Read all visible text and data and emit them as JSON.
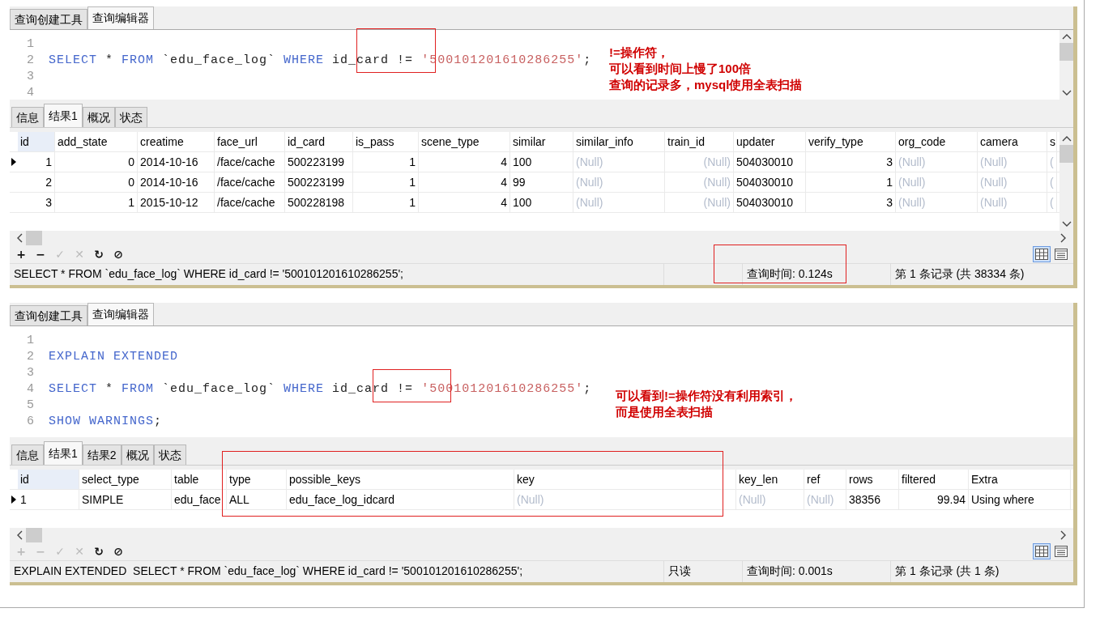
{
  "panels": [
    {
      "query_tabs": [
        {
          "label": "查询创建工具",
          "selected": false
        },
        {
          "label": "查询编辑器",
          "selected": true
        }
      ],
      "editor": {
        "lines": [
          {
            "number": "1"
          },
          {
            "number": "2",
            "tokens": [
              {
                "kind": "keyword",
                "text": "SELECT"
              },
              {
                "kind": "plain",
                "text": " * "
              },
              {
                "kind": "keyword",
                "text": "FROM"
              },
              {
                "kind": "plain",
                "text": " `edu_face_log` "
              },
              {
                "kind": "keyword",
                "text": "WHERE"
              },
              {
                "kind": "plain",
                "text": " id_card != "
              },
              {
                "kind": "string",
                "text": "'500101201610286255'"
              },
              {
                "kind": "plain",
                "text": ";"
              }
            ]
          },
          {
            "number": "3"
          },
          {
            "number": "4"
          }
        ]
      },
      "note": [
        "!=操作符，",
        "可以看到时间上慢了100倍",
        "查询的记录多，mysql使用全表扫描"
      ],
      "result_tabs": [
        {
          "label": "信息",
          "selected": false
        },
        {
          "label": "结果1",
          "selected": true
        },
        {
          "label": "概况",
          "selected": false
        },
        {
          "label": "状态",
          "selected": false
        }
      ],
      "grid": {
        "columns": [
          {
            "label": "id"
          },
          {
            "label": "add_state"
          },
          {
            "label": "creatime"
          },
          {
            "label": "face_url"
          },
          {
            "label": "id_card"
          },
          {
            "label": "is_pass"
          },
          {
            "label": "scene_type"
          },
          {
            "label": "similar"
          },
          {
            "label": "similar_info"
          },
          {
            "label": "train_id"
          },
          {
            "label": "updater"
          },
          {
            "label": "verify_type"
          },
          {
            "label": "org_code"
          },
          {
            "label": "camera"
          },
          {
            "label": "s"
          }
        ],
        "rows": [
          {
            "current": true,
            "cells": [
              {
                "text": "1"
              },
              {
                "text": "0"
              },
              {
                "text": "2014-10-16"
              },
              {
                "text": "/face/cache"
              },
              {
                "text": "500223199"
              },
              {
                "text": "1"
              },
              {
                "text": "4"
              },
              {
                "text": "100"
              },
              {
                "text": "(Null)",
                "kind": "null"
              },
              {
                "text": "(Null)",
                "kind": "null"
              },
              {
                "text": "504030010"
              },
              {
                "text": "3"
              },
              {
                "text": "(Null)",
                "kind": "null"
              },
              {
                "text": "(Null)",
                "kind": "null"
              },
              {
                "text": "(",
                "kind": "null"
              }
            ]
          },
          {
            "current": false,
            "cells": [
              {
                "text": "2"
              },
              {
                "text": "0"
              },
              {
                "text": "2014-10-16"
              },
              {
                "text": "/face/cache"
              },
              {
                "text": "500223199"
              },
              {
                "text": "1"
              },
              {
                "text": "4"
              },
              {
                "text": "99"
              },
              {
                "text": "(Null)",
                "kind": "null"
              },
              {
                "text": "(Null)",
                "kind": "null"
              },
              {
                "text": "504030010"
              },
              {
                "text": "1"
              },
              {
                "text": "(Null)",
                "kind": "null"
              },
              {
                "text": "(Null)",
                "kind": "null"
              },
              {
                "text": "(",
                "kind": "null"
              }
            ]
          },
          {
            "current": false,
            "cells": [
              {
                "text": "3"
              },
              {
                "text": "1"
              },
              {
                "text": "2015-10-12"
              },
              {
                "text": "/face/cache"
              },
              {
                "text": "500228198"
              },
              {
                "text": "1"
              },
              {
                "text": "4"
              },
              {
                "text": "100"
              },
              {
                "text": "(Null)",
                "kind": "null"
              },
              {
                "text": "(Null)",
                "kind": "null"
              },
              {
                "text": "504030010"
              },
              {
                "text": "3"
              },
              {
                "text": "(Null)",
                "kind": "null"
              },
              {
                "text": "(Null)",
                "kind": "null"
              },
              {
                "text": "(",
                "kind": "null"
              }
            ]
          }
        ]
      },
      "tools": [
        {
          "glyph": "+",
          "disabled": false
        },
        {
          "glyph": "−",
          "disabled": false
        },
        {
          "glyph": "✓",
          "disabled": true
        },
        {
          "glyph": "✕",
          "disabled": true
        },
        {
          "glyph": "↻",
          "disabled": false
        },
        {
          "glyph": "⊘",
          "disabled": false
        }
      ],
      "view_modes": [
        {
          "kind": "grid",
          "selected": true
        },
        {
          "kind": "form",
          "selected": false
        }
      ],
      "status": {
        "sql": "SELECT * FROM `edu_face_log` WHERE id_card != '500101201610286255';",
        "time": "查询时间: 0.124s",
        "records": "第 1 条记录 (共 38334 条)"
      }
    },
    {
      "query_tabs": [
        {
          "label": "查询创建工具",
          "selected": false
        },
        {
          "label": "查询编辑器",
          "selected": true
        }
      ],
      "editor": {
        "lines": [
          {
            "number": "1"
          },
          {
            "number": "2",
            "tokens": [
              {
                "kind": "keyword",
                "text": "EXPLAIN EXTENDED"
              }
            ]
          },
          {
            "number": "3"
          },
          {
            "number": "4",
            "tokens": [
              {
                "kind": "keyword",
                "text": "SELECT"
              },
              {
                "kind": "plain",
                "text": " * "
              },
              {
                "kind": "keyword",
                "text": "FROM"
              },
              {
                "kind": "plain",
                "text": " `edu_face_log` "
              },
              {
                "kind": "keyword",
                "text": "WHERE"
              },
              {
                "kind": "plain",
                "text": " id_card != "
              },
              {
                "kind": "string",
                "text": "'500101201610286255'"
              },
              {
                "kind": "plain",
                "text": ";"
              }
            ]
          },
          {
            "number": "5"
          },
          {
            "number": "6",
            "tokens": [
              {
                "kind": "keyword",
                "text": "SHOW WARNINGS"
              },
              {
                "kind": "plain",
                "text": ";"
              }
            ]
          }
        ]
      },
      "note": [
        "可以看到!=操作符没有利用索引，",
        "而是使用全表扫描"
      ],
      "result_tabs": [
        {
          "label": "信息",
          "selected": false
        },
        {
          "label": "结果1",
          "selected": true
        },
        {
          "label": "结果2",
          "selected": false
        },
        {
          "label": "概况",
          "selected": false
        },
        {
          "label": "状态",
          "selected": false
        }
      ],
      "grid": {
        "columns": [
          {
            "label": "id"
          },
          {
            "label": "select_type"
          },
          {
            "label": "table"
          },
          {
            "label": "type"
          },
          {
            "label": "possible_keys"
          },
          {
            "label": "key"
          },
          {
            "label": "key_len"
          },
          {
            "label": "ref"
          },
          {
            "label": "rows"
          },
          {
            "label": "filtered"
          },
          {
            "label": "Extra"
          }
        ],
        "rows": [
          {
            "current": true,
            "cells": [
              {
                "text": "1"
              },
              {
                "text": "SIMPLE"
              },
              {
                "text": "edu_face"
              },
              {
                "text": "ALL"
              },
              {
                "text": "edu_face_log_idcard"
              },
              {
                "text": "(Null)",
                "kind": "null"
              },
              {
                "text": "(Null)",
                "kind": "null"
              },
              {
                "text": "(Null)",
                "kind": "null"
              },
              {
                "text": "38356"
              },
              {
                "text": "99.94"
              },
              {
                "text": "Using where"
              }
            ]
          }
        ]
      },
      "tools": [
        {
          "glyph": "+",
          "disabled": true
        },
        {
          "glyph": "−",
          "disabled": true
        },
        {
          "glyph": "✓",
          "disabled": true
        },
        {
          "glyph": "✕",
          "disabled": true
        },
        {
          "glyph": "↻",
          "disabled": false
        },
        {
          "glyph": "⊘",
          "disabled": false
        }
      ],
      "view_modes": [
        {
          "kind": "grid",
          "selected": true
        },
        {
          "kind": "form",
          "selected": false
        }
      ],
      "status": {
        "sql": "EXPLAIN EXTENDED  SELECT * FROM `edu_face_log` WHERE id_card != '500101201610286255';",
        "mode": "只读",
        "time": "查询时间: 0.001s",
        "records": "第 1 条记录 (共 1 条)"
      }
    }
  ]
}
